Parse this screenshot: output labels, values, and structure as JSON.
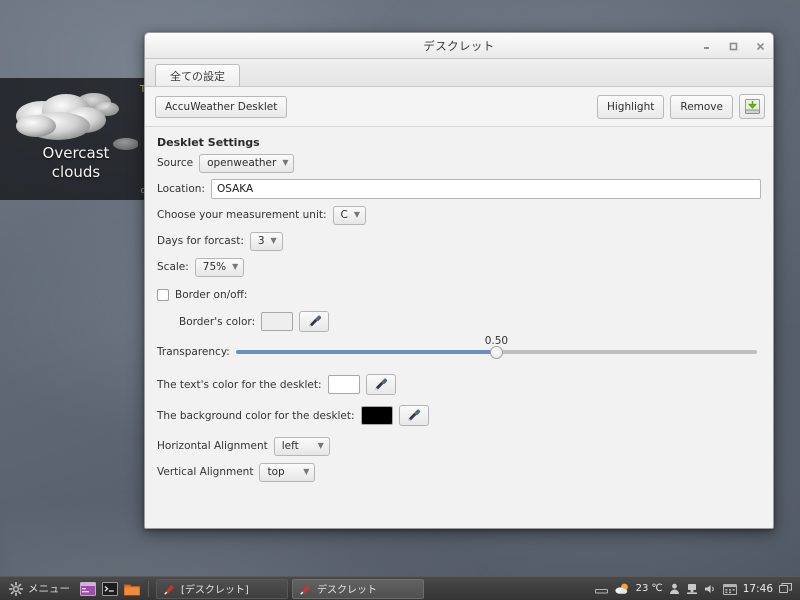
{
  "desktop": {
    "desklet": {
      "icon": "overcast-clouds-icon",
      "temperature": "T",
      "label_line1": "Overcast",
      "label_line2": "clouds",
      "sub": "o"
    }
  },
  "window": {
    "title": "デスクレット",
    "controls": {
      "minimize": "minimize-icon",
      "maximize": "maximize-icon",
      "close": "close-icon"
    },
    "tabs": [
      {
        "label": "全ての設定",
        "active": true
      }
    ],
    "header": {
      "desklet_name": "AccuWeather Desklet",
      "highlight_label": "Highlight",
      "remove_label": "Remove",
      "install_icon": "install-desklet-icon"
    },
    "settings": {
      "group_title": "Desklet Settings",
      "source": {
        "label": "Source",
        "value": "openweather"
      },
      "location": {
        "label": "Location:",
        "value": "OSAKA"
      },
      "unit": {
        "label": "Choose your measurement unit:",
        "value": "C"
      },
      "days": {
        "label": "Days for forcast:",
        "value": "3"
      },
      "scale": {
        "label": "Scale:",
        "value": "75%"
      },
      "border_toggle": {
        "label": "Border on/off:",
        "checked": false
      },
      "border_color": {
        "label": "Border's color:",
        "swatch": "#eeeeee"
      },
      "transparency": {
        "label": "Transparency:",
        "value": "0.50",
        "percent": 50
      },
      "text_color": {
        "label": "The text's color for the desklet:",
        "swatch": "#ffffff"
      },
      "bg_color": {
        "label": "The background color for the desklet:",
        "swatch": "#000000"
      },
      "h_align": {
        "label": "Horizontal Alignment",
        "value": "left"
      },
      "v_align": {
        "label": "Vertical Alignment",
        "value": "top"
      }
    }
  },
  "taskbar": {
    "menu": {
      "icon": "gear-icon",
      "label": "メニュー"
    },
    "launchers": [
      {
        "name": "show-desktop-icon"
      },
      {
        "name": "terminal-icon"
      },
      {
        "name": "file-manager-icon"
      }
    ],
    "windows": [
      {
        "label": "[デスクレット]",
        "active": false
      },
      {
        "label": "デスクレット",
        "active": true
      }
    ],
    "tray": {
      "keyboard_icon": "keyboard-icon",
      "weather_icon": "weather-icon",
      "temperature": "23 ℃",
      "user_icon": "user-icon",
      "network_icon": "network-icon",
      "volume_icon": "volume-icon",
      "calendar_icon": "calendar-icon",
      "clock": "17:46",
      "workspace_icon": "workspace-icon"
    }
  }
}
